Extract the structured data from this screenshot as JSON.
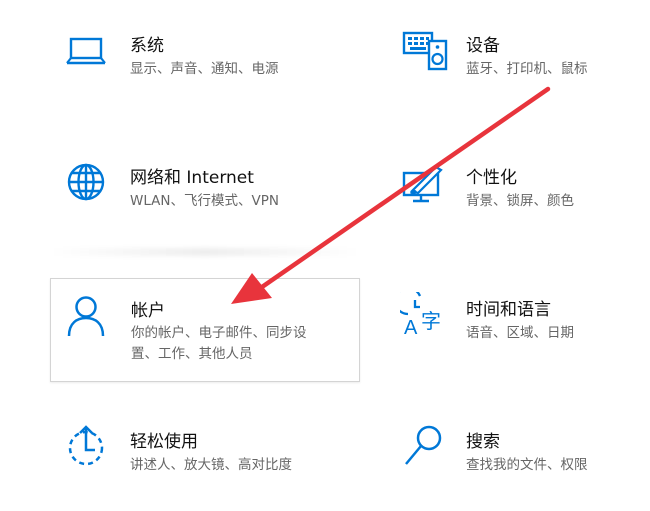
{
  "accent_color": "#0078d7",
  "annotation_arrow_color": "#e8343c",
  "tiles": [
    {
      "icon": "laptop-icon",
      "title": "系统",
      "desc": "显示、声音、通知、电源"
    },
    {
      "icon": "keyboard-speaker-icon",
      "title": "设备",
      "desc": "蓝牙、打印机、鼠标"
    },
    {
      "icon": "globe-icon",
      "title": "网络和 Internet",
      "desc": "WLAN、飞行模式、VPN"
    },
    {
      "icon": "paint-monitor-icon",
      "title": "个性化",
      "desc": "背景、锁屏、颜色"
    },
    {
      "icon": "person-icon",
      "title": "帐户",
      "desc_line1": "你的帐户、电子邮件、同步设",
      "desc_line2": "置、工作、其他人员"
    },
    {
      "icon": "clock-language-icon",
      "title": "时间和语言",
      "desc": "语音、区域、日期"
    },
    {
      "icon": "ease-of-access-icon",
      "title": "轻松使用",
      "desc": "讲述人、放大镜、高对比度"
    },
    {
      "icon": "search-icon",
      "title": "搜索",
      "desc": "查找我的文件、权限"
    }
  ]
}
